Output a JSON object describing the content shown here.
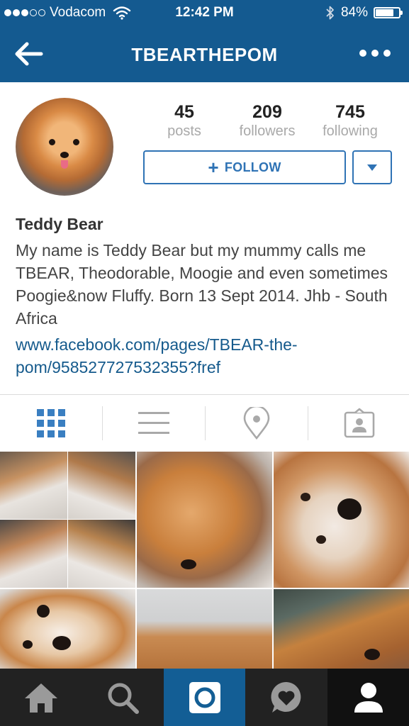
{
  "status_bar": {
    "carrier": "Vodacom",
    "signal_bars": 3,
    "signal_total": 5,
    "time": "12:42 PM",
    "battery": "84%",
    "battery_level": 0.84
  },
  "nav": {
    "title": "TBEARTHEPOM",
    "back_icon": "back-arrow-icon",
    "more_icon": "more-dots-icon"
  },
  "profile": {
    "avatar_icon": "profile-photo",
    "stats": [
      {
        "value": "45",
        "label": "posts"
      },
      {
        "value": "209",
        "label": "followers"
      },
      {
        "value": "745",
        "label": "following"
      }
    ],
    "follow_label": "FOLLOW",
    "full_name": "Teddy Bear",
    "bio": "My name is Teddy Bear but my mummy calls me TBEAR, Theodorable, Moogie and even sometimes Poogie&now Fluffy. Born 13 Sept 2014. Jhb - South Africa",
    "link": "www.facebook.com/pages/TBEAR-the-pom/958527727532355?fref"
  },
  "view_tabs": [
    {
      "name": "grid-view",
      "icon": "grid-icon",
      "active": true
    },
    {
      "name": "list-view",
      "icon": "list-icon",
      "active": false
    },
    {
      "name": "places-view",
      "icon": "location-pin-icon",
      "active": false
    },
    {
      "name": "tagged-view",
      "icon": "tagged-person-icon",
      "active": false
    }
  ],
  "bottom_tabs": [
    {
      "name": "home",
      "icon": "home-icon",
      "active": false
    },
    {
      "name": "explore",
      "icon": "search-icon",
      "active": false
    },
    {
      "name": "camera",
      "icon": "camera-icon",
      "active": false
    },
    {
      "name": "activity",
      "icon": "heart-bubble-icon",
      "active": false
    },
    {
      "name": "profile",
      "icon": "person-icon",
      "active": true
    }
  ],
  "colors": {
    "brand_blue": "#145a90",
    "link_blue": "#155a8c",
    "button_blue": "#2f73b5",
    "active_tab_blue": "#3a7fc1",
    "tabbar_dark": "#222222",
    "camera_highlight": "#135e95",
    "profile_highlight": "#111111"
  }
}
